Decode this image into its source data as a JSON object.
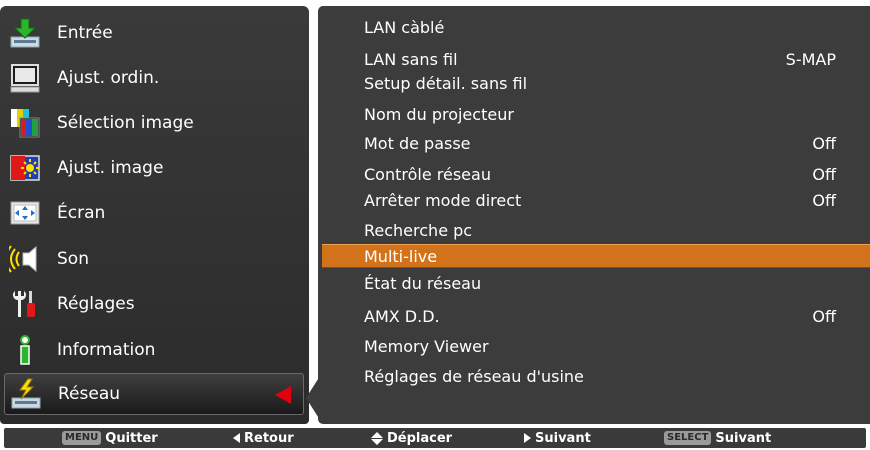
{
  "menu": {
    "items": [
      {
        "label": "Entrée",
        "icon": "input-icon"
      },
      {
        "label": "Ajust. ordin.",
        "icon": "computer-icon"
      },
      {
        "label": "Sélection image",
        "icon": "image-select-icon"
      },
      {
        "label": "Ajust. image",
        "icon": "image-adjust-icon"
      },
      {
        "label": "Écran",
        "icon": "screen-icon"
      },
      {
        "label": "Son",
        "icon": "sound-icon"
      },
      {
        "label": "Réglages",
        "icon": "settings-icon"
      },
      {
        "label": "Information",
        "icon": "information-icon"
      },
      {
        "label": "Réseau",
        "icon": "network-icon"
      }
    ],
    "selected_index": 8,
    "accent_color": "#e3000f"
  },
  "submenu": {
    "items": [
      {
        "label": "LAN càblé",
        "value": ""
      },
      {
        "label": "LAN sans fil",
        "value": "S-MAP"
      },
      {
        "label": "Setup détail. sans fil",
        "value": ""
      },
      {
        "label": "Nom du projecteur",
        "value": ""
      },
      {
        "label": "Mot de passe",
        "value": "Off"
      },
      {
        "label": "Contrôle réseau",
        "value": "Off"
      },
      {
        "label": "Arrêter mode direct",
        "value": "Off"
      },
      {
        "label": "Recherche pc",
        "value": ""
      },
      {
        "label": "Multi-live",
        "value": ""
      },
      {
        "label": "État du réseau",
        "value": ""
      },
      {
        "label": "AMX D.D.",
        "value": "Off"
      },
      {
        "label": "Memory Viewer",
        "value": ""
      },
      {
        "label": "Réglages de réseau d'usine",
        "value": ""
      }
    ],
    "selected_index": 8,
    "highlight_color": "#d2731c"
  },
  "footer": {
    "menu_key": "MENU",
    "quit": "Quitter",
    "back": "Retour",
    "move": "Déplacer",
    "next1": "Suivant",
    "select_key": "SELECT",
    "next2": "Suivant"
  }
}
